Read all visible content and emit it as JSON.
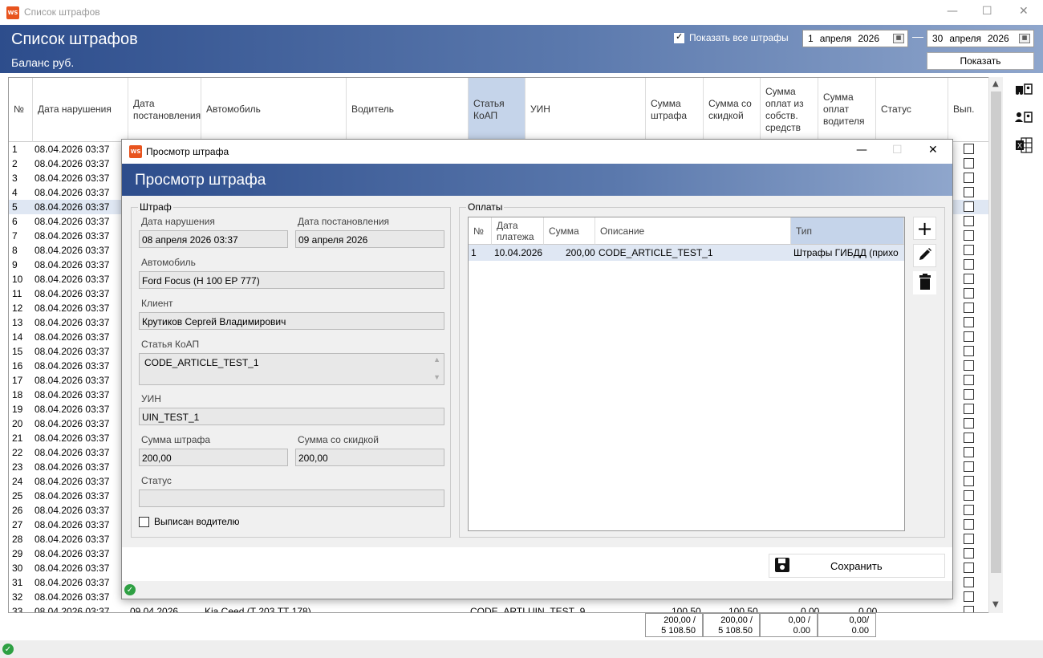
{
  "window": {
    "title": "Список штрафов",
    "logo": "WS"
  },
  "header": {
    "title": "Список штрафов",
    "balance": "Баланс  руб.",
    "show_all_label": "Показать все штрафы",
    "show_all_checked": true,
    "date_from": {
      "day": "1",
      "month": "апреля",
      "year": "2026"
    },
    "date_to": {
      "day": "30",
      "month": "апреля",
      "year": "2026"
    },
    "show_button": "Показать"
  },
  "grid": {
    "columns": [
      "№",
      "Дата нарушения",
      "Дата постановления",
      "Автомобиль",
      "Водитель",
      "Статья КоАП",
      "УИН",
      "Сумма штрафа",
      "Сумма со скидкой",
      "Сумма оплат из собств. средств",
      "Сумма оплат водителя",
      "Статус",
      "Вып."
    ],
    "rows": [
      {
        "n": "1",
        "date": "08.04.2026 03:37"
      },
      {
        "n": "2",
        "date": "08.04.2026 03:37"
      },
      {
        "n": "3",
        "date": "08.04.2026 03:37"
      },
      {
        "n": "4",
        "date": "08.04.2026 03:37"
      },
      {
        "n": "5",
        "date": "08.04.2026 03:37"
      },
      {
        "n": "6",
        "date": "08.04.2026 03:37"
      },
      {
        "n": "7",
        "date": "08.04.2026 03:37"
      },
      {
        "n": "8",
        "date": "08.04.2026 03:37"
      },
      {
        "n": "9",
        "date": "08.04.2026 03:37"
      },
      {
        "n": "10",
        "date": "08.04.2026 03:37"
      },
      {
        "n": "11",
        "date": "08.04.2026 03:37"
      },
      {
        "n": "12",
        "date": "08.04.2026 03:37"
      },
      {
        "n": "13",
        "date": "08.04.2026 03:37"
      },
      {
        "n": "14",
        "date": "08.04.2026 03:37"
      },
      {
        "n": "15",
        "date": "08.04.2026 03:37"
      },
      {
        "n": "16",
        "date": "08.04.2026 03:37"
      },
      {
        "n": "17",
        "date": "08.04.2026 03:37"
      },
      {
        "n": "18",
        "date": "08.04.2026 03:37"
      },
      {
        "n": "19",
        "date": "08.04.2026 03:37"
      },
      {
        "n": "20",
        "date": "08.04.2026 03:37"
      },
      {
        "n": "21",
        "date": "08.04.2026 03:37"
      },
      {
        "n": "22",
        "date": "08.04.2026 03:37"
      },
      {
        "n": "23",
        "date": "08.04.2026 03:37"
      },
      {
        "n": "24",
        "date": "08.04.2026 03:37"
      },
      {
        "n": "25",
        "date": "08.04.2026 03:37"
      },
      {
        "n": "26",
        "date": "08.04.2026 03:37"
      },
      {
        "n": "27",
        "date": "08.04.2026 03:37"
      },
      {
        "n": "28",
        "date": "08.04.2026 03:37"
      },
      {
        "n": "29",
        "date": "08.04.2026 03:37"
      },
      {
        "n": "30",
        "date": "08.04.2026 03:37"
      },
      {
        "n": "31",
        "date": "08.04.2026 03:37"
      },
      {
        "n": "32",
        "date": "08.04.2026 03:37"
      },
      {
        "n": "33",
        "date": "08.04.2026 03:37",
        "decree": "09.04.2026",
        "car": "Kia Ceed (Т 203 ТТ 178)",
        "article": "CODE_ARTI",
        "uin": "UIN_TEST_9",
        "fine": "100,50",
        "discount": "100,50",
        "own": "0,00",
        "driver": "0,00"
      }
    ],
    "selected_row": 5,
    "totals": {
      "fine": "200,00 /\n5 108.50",
      "discount": "200,00 /\n5 108.50",
      "own": "0,00 /\n0.00",
      "driver": "0,00/\n0.00"
    }
  },
  "dialog": {
    "window_title": "Просмотр штрафа",
    "title": "Просмотр штрафа",
    "fine_group": "Штраф",
    "violation_date_label": "Дата нарушения",
    "violation_date": "08 апреля 2026 03:37",
    "decree_date_label": "Дата постановления",
    "decree_date": "09 апреля 2026",
    "car_label": "Автомобиль",
    "car": "Ford Focus (Н 100 ЕР 777)",
    "client_label": "Клиент",
    "client": "Крутиков Сергей Владимирович",
    "article_label": "Статья КоАП",
    "article": "CODE_ARTICLE_TEST_1",
    "uin_label": "УИН",
    "uin": "UIN_TEST_1",
    "fine_label": "Сумма штрафа",
    "fine": "200,00",
    "discount_label": "Сумма со скидкой",
    "discount": "200,00",
    "status_label": "Статус",
    "status": "",
    "driver_issued_label": "Выписан водителю",
    "driver_issued": false,
    "payments_group": "Оплаты",
    "payments_columns": [
      "№",
      "Дата платежа",
      "Сумма",
      "Описание",
      "Тип"
    ],
    "payments": [
      {
        "n": "1",
        "date": "10.04.2026",
        "sum": "200,00",
        "desc": "CODE_ARTICLE_TEST_1",
        "type": "Штрафы ГИБДД (прихо"
      }
    ],
    "save_button": "Сохранить"
  }
}
